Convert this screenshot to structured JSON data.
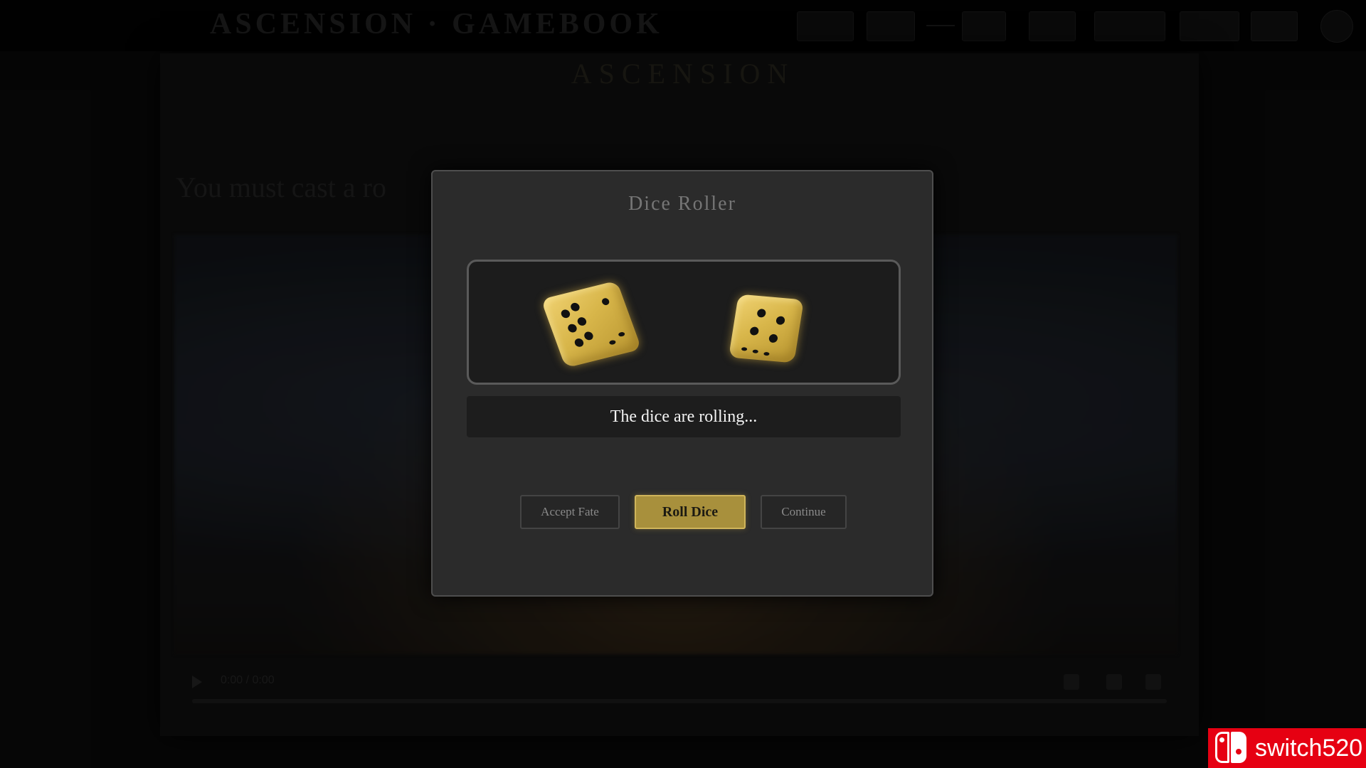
{
  "header": {
    "title": "ASCENSION · GAMEBOOK",
    "nav_buttons": [
      "",
      "",
      "",
      "",
      "",
      "",
      ""
    ]
  },
  "chapter": {
    "heading": "ASCENSION",
    "prompt": "You must cast a ro"
  },
  "video": {
    "time": "0:00 / 0:00"
  },
  "dice_roller": {
    "title": "Dice Roller",
    "status": "The dice are rolling...",
    "dice": [
      {
        "face_value": 6,
        "color": "#d8b64a"
      },
      {
        "face_value": 4,
        "color": "#d8b64a"
      }
    ],
    "buttons": {
      "accept": "Accept Fate",
      "roll": "Roll Dice",
      "continue": "Continue"
    }
  },
  "watermark": {
    "text": "switch520",
    "color": "#e60012"
  },
  "icons": [
    "play-icon",
    "volume-icon",
    "settings-icon",
    "fullscreen-icon",
    "switch-logo-icon"
  ]
}
